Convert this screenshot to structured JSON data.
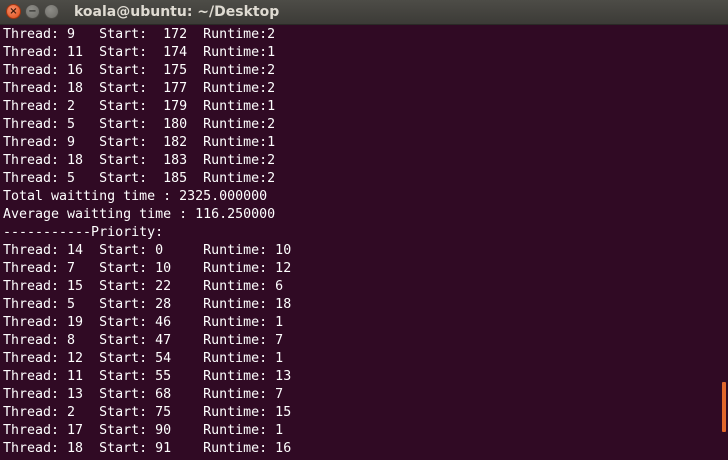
{
  "window": {
    "title": "koala@ubuntu: ~/Desktop",
    "close_glyph": "×",
    "minimize_glyph": "−",
    "maximize_glyph": "",
    "accent_color": "#e0662c",
    "background_color": "#300a24",
    "text_color": "#ffffff"
  },
  "terminal": {
    "lines": [
      "Thread: 9   Start:  172  Runtime:2",
      "Thread: 11  Start:  174  Runtime:1",
      "Thread: 16  Start:  175  Runtime:2",
      "Thread: 18  Start:  177  Runtime:2",
      "Thread: 2   Start:  179  Runtime:1",
      "Thread: 5   Start:  180  Runtime:2",
      "Thread: 9   Start:  182  Runtime:1",
      "Thread: 18  Start:  183  Runtime:2",
      "Thread: 5   Start:  185  Runtime:2",
      "Total waitting time : 2325.000000",
      "Average waitting time : 116.250000",
      "-----------Priority:",
      "Thread: 14  Start: 0     Runtime: 10",
      "Thread: 7   Start: 10    Runtime: 12",
      "Thread: 15  Start: 22    Runtime: 6",
      "Thread: 5   Start: 28    Runtime: 18",
      "Thread: 19  Start: 46    Runtime: 1",
      "Thread: 8   Start: 47    Runtime: 7",
      "Thread: 12  Start: 54    Runtime: 1",
      "Thread: 11  Start: 55    Runtime: 13",
      "Thread: 13  Start: 68    Runtime: 7",
      "Thread: 2   Start: 75    Runtime: 15",
      "Thread: 17  Start: 90    Runtime: 1",
      "Thread: 18  Start: 91    Runtime: 16"
    ]
  }
}
